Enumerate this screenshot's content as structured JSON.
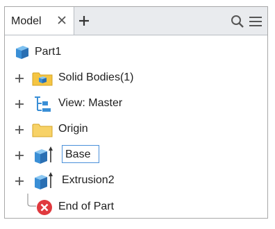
{
  "browser": {
    "tab": {
      "label": "Model",
      "close_icon": "close-icon"
    },
    "add_tab_icon": "plus-icon",
    "search_icon": "search-icon",
    "menu_icon": "hamburger-menu-icon"
  },
  "tree": {
    "root": {
      "label": "Part1",
      "icon": "part-cube-icon"
    },
    "items": [
      {
        "label": "Solid Bodies(1)",
        "icon": "solid-bodies-folder-icon"
      },
      {
        "label": "View: Master",
        "icon": "view-representation-icon"
      },
      {
        "label": "Origin",
        "icon": "folder-icon"
      },
      {
        "label": "Base",
        "icon": "extrusion-feature-icon",
        "editing": true
      },
      {
        "label": "Extrusion2",
        "icon": "extrusion-feature-icon"
      }
    ],
    "end": {
      "label": "End of Part",
      "icon": "end-of-part-icon"
    }
  },
  "colors": {
    "cube_blue": "#3a8fd6",
    "folder_yellow": "#f5c542",
    "end_red": "#e0393e",
    "edit_border": "#4a90d9"
  }
}
